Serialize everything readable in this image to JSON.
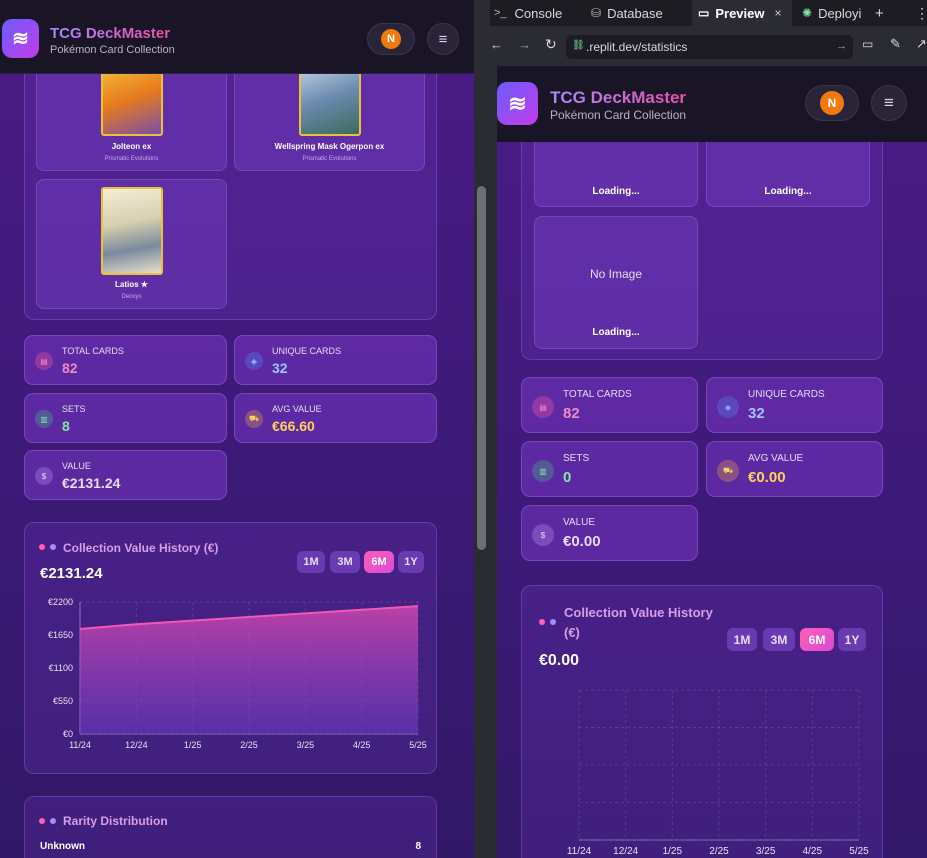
{
  "brand": {
    "title": "TCG DeckMaster",
    "subtitle": "Pokémon Card Collection"
  },
  "user": {
    "avatar_initial": "N"
  },
  "left": {
    "cards": [
      {
        "name": "Jolteon ex",
        "set": "Prismatic Evolutions"
      },
      {
        "name": "Wellspring Mask Ogerpon ex",
        "set": "Prismatic Evolutions"
      },
      {
        "name": "Latios ★",
        "set": "Deoxys"
      }
    ],
    "stats": [
      {
        "label": "TOTAL CARDS",
        "value": "82"
      },
      {
        "label": "UNIQUE CARDS",
        "value": "32"
      },
      {
        "label": "SETS",
        "value": "8"
      },
      {
        "label": "AVG VALUE",
        "value": "€66.60"
      },
      {
        "label": "VALUE",
        "value": "€2131.24"
      }
    ],
    "history": {
      "title": "Collection Value History (€)",
      "current": "€2131.24"
    },
    "rarity": {
      "title": "Rarity Distribution",
      "rows": [
        {
          "label": "Unknown",
          "count": "8"
        }
      ]
    }
  },
  "ranges": [
    "1M",
    "3M",
    "6M",
    "1Y"
  ],
  "active_range": "6M",
  "ide_tabs": {
    "console": "Console",
    "database": "Database",
    "preview": "Preview",
    "deploy": "Deployi"
  },
  "browser": {
    "url": ".replit.dev/statistics"
  },
  "right": {
    "loading_text": "Loading...",
    "no_image_text": "No Image",
    "stats": [
      {
        "label": "TOTAL CARDS",
        "value": "82"
      },
      {
        "label": "UNIQUE CARDS",
        "value": "32"
      },
      {
        "label": "SETS",
        "value": "0"
      },
      {
        "label": "AVG VALUE",
        "value": "€0.00"
      },
      {
        "label": "VALUE",
        "value": "€0.00"
      }
    ],
    "history": {
      "title_line1": "Collection Value History",
      "title_line2": "(€)",
      "current": "€0.00"
    }
  },
  "colors": {
    "accent_pink": "#ff5fb8",
    "accent_purple": "#a78bff",
    "stat_pink": "#f08ac8",
    "stat_blue": "#9ec4ff",
    "stat_green": "#7ee8a6",
    "stat_gold": "#ffd25a"
  },
  "chart_data": [
    {
      "type": "area",
      "title": "Collection Value History (€)",
      "x": [
        "11/24",
        "12/24",
        "1/25",
        "2/25",
        "3/25",
        "4/25",
        "5/25"
      ],
      "series": [
        {
          "values": [
            1750,
            1830,
            1890,
            1950,
            2010,
            2070,
            2131.24
          ]
        }
      ],
      "yticks": [
        "€2200",
        "€1650",
        "€1100",
        "€550",
        "€0"
      ],
      "ylim": [
        0,
        2200
      ],
      "grid": true
    },
    {
      "type": "area",
      "title": "Collection Value History (€)",
      "x": [
        "11/24",
        "12/24",
        "1/25",
        "2/25",
        "3/25",
        "4/25",
        "5/25"
      ],
      "series": [
        {
          "values": []
        }
      ],
      "grid": true
    }
  ]
}
